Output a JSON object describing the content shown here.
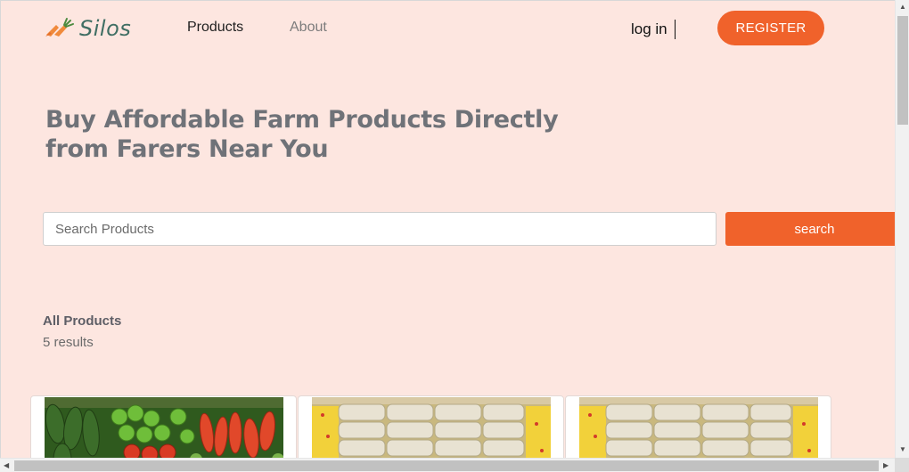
{
  "brand": {
    "name": "Silos",
    "logo_icon": "carrot-logo-icon"
  },
  "nav": {
    "products": "Products",
    "about": "About"
  },
  "auth": {
    "login": "log in",
    "register": "REGISTER"
  },
  "hero": {
    "title": "Buy Affordable Farm Products Directly from Farers Near You"
  },
  "search": {
    "placeholder": "Search Products",
    "value": "",
    "button": "search"
  },
  "results": {
    "title": "All Products",
    "count": "5 results"
  },
  "products": [
    {
      "image": "vegetables-image"
    },
    {
      "image": "rice-bags-image"
    },
    {
      "image": "rice-bags-image"
    }
  ],
  "colors": {
    "accent": "#f0622b",
    "background": "#fde6e0",
    "brand": "#3f6e63",
    "heading": "#6f7278"
  }
}
